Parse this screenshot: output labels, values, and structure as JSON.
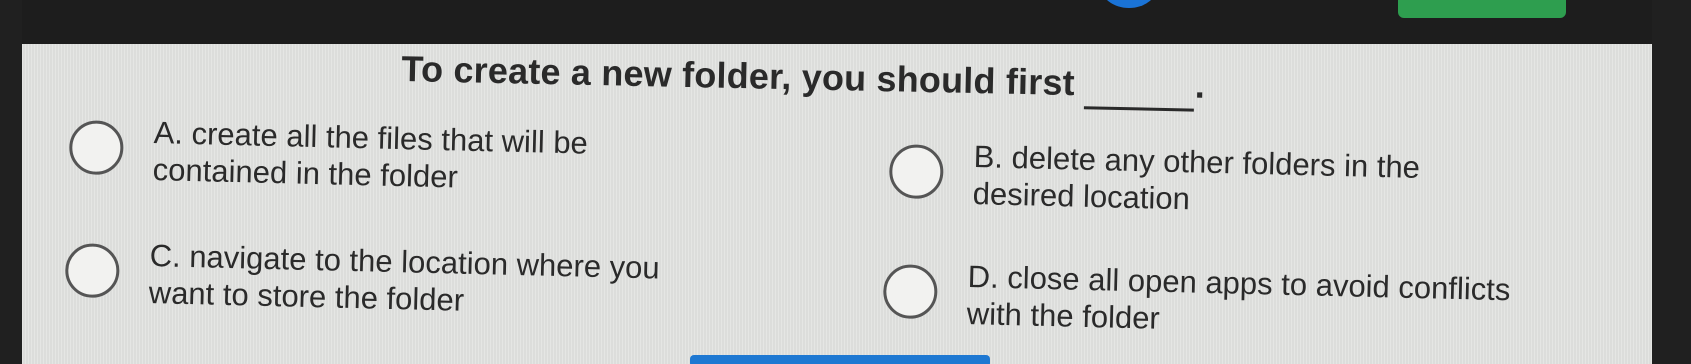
{
  "question": {
    "text": "To create a new folder, you should first",
    "end_punct": "."
  },
  "options": [
    {
      "lines": [
        "A. create all the files that will be",
        "contained in the folder"
      ]
    },
    {
      "lines": [
        "B. delete any other folders in the",
        "desired location"
      ]
    },
    {
      "lines": [
        "C. navigate to the location where you",
        "want to store the folder"
      ]
    },
    {
      "lines": [
        "D. close all open apps to avoid conflicts",
        "with the folder"
      ]
    }
  ],
  "colors": {
    "panel_background": "#e3e4e2",
    "text": "#2a2a2a",
    "submit_green": "#2e9e4f",
    "accent_blue": "#1a73d6"
  }
}
